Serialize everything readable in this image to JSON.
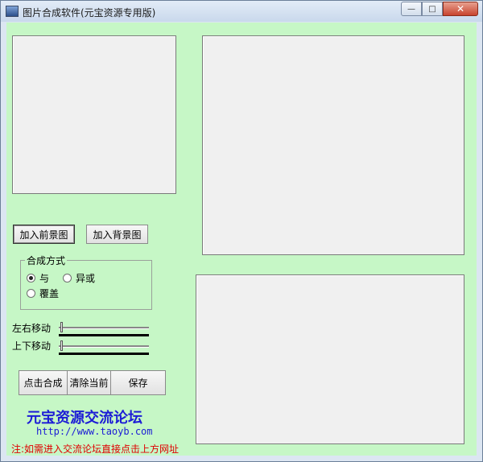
{
  "window": {
    "title": "图片合成软件(元宝资源专用版)",
    "minimize_glyph": "—",
    "maximize_glyph": "□",
    "close_glyph": "✕"
  },
  "buttons": {
    "add_foreground": "加入前景图",
    "add_background": "加入背景图",
    "compose": "点击合成",
    "clear": "清除当前",
    "save": "保存"
  },
  "blend_mode": {
    "group_label": "合成方式",
    "options": [
      {
        "label": "与",
        "selected": true
      },
      {
        "label": "异或",
        "selected": false
      },
      {
        "label": "覆盖",
        "selected": false
      }
    ]
  },
  "sliders": {
    "horizontal_label": "左右移动",
    "vertical_label": "上下移动",
    "horizontal_value": 0,
    "vertical_value": 0
  },
  "footer": {
    "forum_name": "元宝资源交流论坛",
    "url": "http://www.taoyb.com",
    "note": "注:如需进入交流论坛直接点击上方网址"
  },
  "colors": {
    "client_background": "#c6f7c6",
    "forum_text": "#1c1cd6",
    "note_text": "#e00000"
  }
}
